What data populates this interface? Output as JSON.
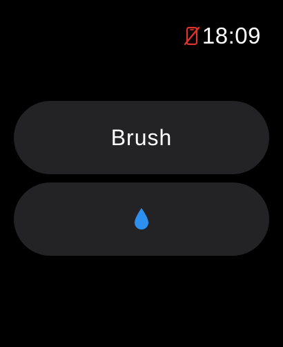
{
  "status_bar": {
    "connection_icon": "phone-disconnected-icon",
    "connection_color": "#e0352b",
    "time": "18:09"
  },
  "actions": {
    "brush_label": "Brush",
    "water_icon": "water-drop-icon",
    "water_icon_color": "#2f8ff0"
  },
  "colors": {
    "background": "#000000",
    "button_background": "#232325",
    "text": "#ffffff"
  }
}
